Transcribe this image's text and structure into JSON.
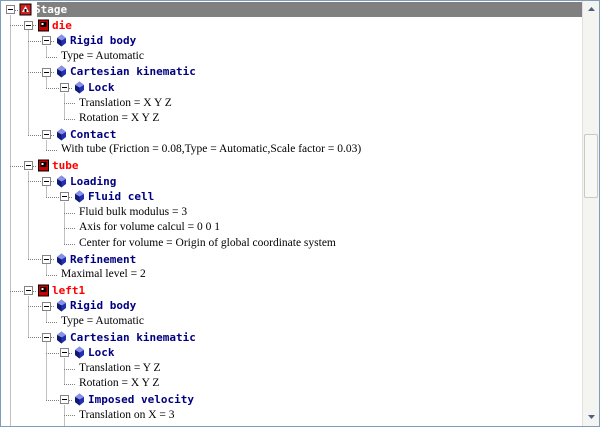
{
  "tree": {
    "root": {
      "label": "Stage"
    },
    "nodes": [
      {
        "level": 1,
        "kind": "object",
        "label": "die"
      },
      {
        "level": 2,
        "kind": "category",
        "label": "Rigid body"
      },
      {
        "level": 3,
        "kind": "leaf",
        "label": "Type = Automatic"
      },
      {
        "level": 2,
        "kind": "category",
        "label": "Cartesian kinematic"
      },
      {
        "level": 3,
        "kind": "category",
        "label": "Lock"
      },
      {
        "level": 4,
        "kind": "leaf",
        "label": "Translation = X Y Z"
      },
      {
        "level": 4,
        "kind": "leaf",
        "label": "Rotation = X Y Z"
      },
      {
        "level": 2,
        "kind": "category",
        "label": "Contact"
      },
      {
        "level": 3,
        "kind": "leaf",
        "label": "With tube (Friction = 0.08,Type = Automatic,Scale factor = 0.03)"
      },
      {
        "level": 1,
        "kind": "object",
        "label": "tube"
      },
      {
        "level": 2,
        "kind": "category",
        "label": "Loading"
      },
      {
        "level": 3,
        "kind": "category",
        "label": "Fluid cell"
      },
      {
        "level": 4,
        "kind": "leaf",
        "label": "Fluid bulk modulus = 3"
      },
      {
        "level": 4,
        "kind": "leaf",
        "label": "Axis for volume calcul = 0 0 1"
      },
      {
        "level": 4,
        "kind": "leaf",
        "label": "Center for volume = Origin of global coordinate system"
      },
      {
        "level": 2,
        "kind": "category",
        "label": "Refinement"
      },
      {
        "level": 3,
        "kind": "leaf",
        "label": "Maximal level = 2"
      },
      {
        "level": 1,
        "kind": "object",
        "label": "left1"
      },
      {
        "level": 2,
        "kind": "category",
        "label": "Rigid body"
      },
      {
        "level": 3,
        "kind": "leaf",
        "label": "Type = Automatic"
      },
      {
        "level": 2,
        "kind": "category",
        "label": "Cartesian kinematic"
      },
      {
        "level": 3,
        "kind": "category",
        "label": "Lock"
      },
      {
        "level": 4,
        "kind": "leaf",
        "label": "Translation = Y Z"
      },
      {
        "level": 4,
        "kind": "leaf",
        "label": "Rotation = X Y Z"
      },
      {
        "level": 3,
        "kind": "category",
        "label": "Imposed velocity"
      },
      {
        "level": 4,
        "kind": "leaf",
        "label": "Translation on X = 3"
      }
    ]
  },
  "icons": {
    "root": "stage-icon",
    "object": "object-icon",
    "category": "blue-gem-icon",
    "toggle": "collapse-toggle-icon"
  },
  "colors": {
    "object": "#ff0000",
    "category": "#000080",
    "selection": "#808080"
  }
}
